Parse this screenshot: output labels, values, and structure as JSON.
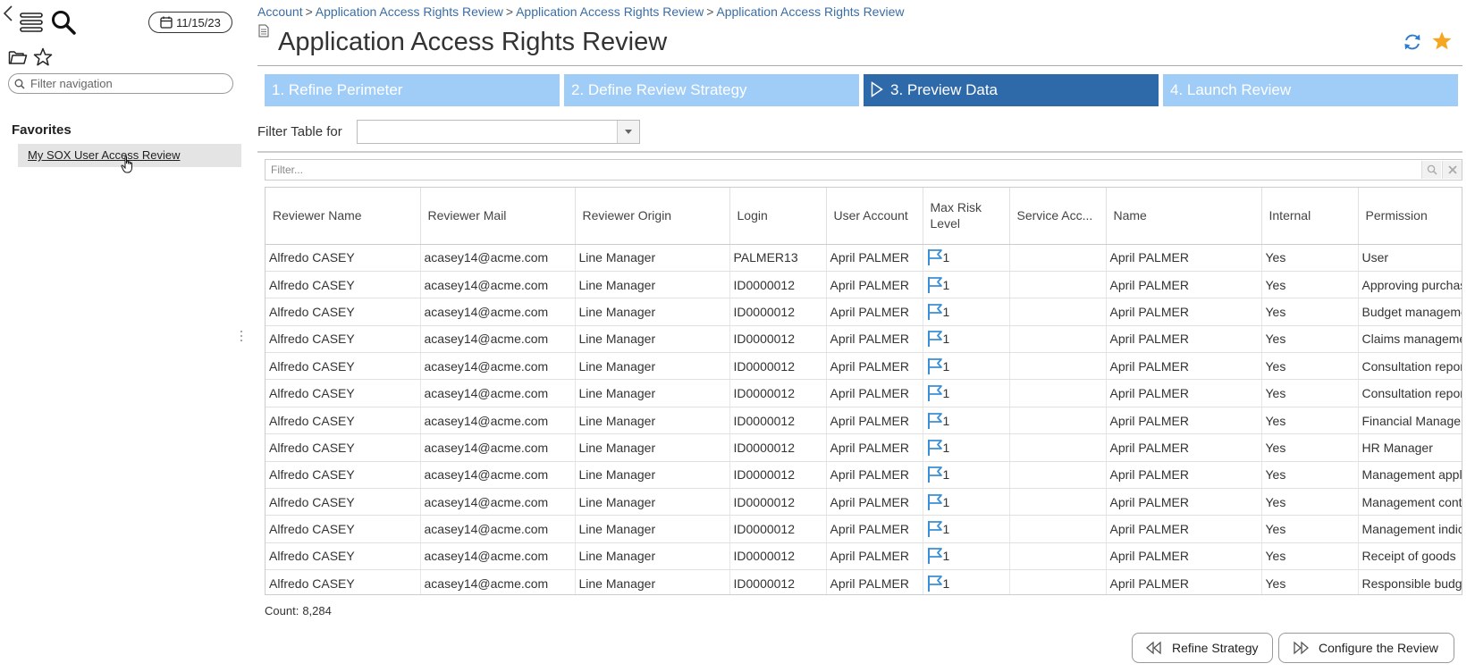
{
  "sidebar": {
    "date": "11/15/23",
    "filter_placeholder": "Filter navigation",
    "favorites_title": "Favorites",
    "favorites": [
      "My SOX User Access Review"
    ],
    "icons": [
      "back-icon",
      "menu-icon",
      "search-icon",
      "calendar-icon",
      "folder-icon",
      "star-icon",
      "hand-cursor-icon"
    ]
  },
  "breadcrumb": {
    "items": [
      "Account",
      "Application Access Rights Review",
      "Application Access Rights Review",
      "Application Access Rights Review"
    ],
    "separator": ">"
  },
  "page": {
    "title": "Application Access Rights Review"
  },
  "steps": [
    {
      "label": "1. Refine Perimeter",
      "active": false
    },
    {
      "label": "2. Define Review Strategy",
      "active": false
    },
    {
      "label": "3. Preview Data",
      "active": true
    },
    {
      "label": "4. Launch Review",
      "active": false
    }
  ],
  "filter_table": {
    "label": "Filter Table for",
    "value": ""
  },
  "grid": {
    "filter_placeholder": "Filter...",
    "columns": [
      "Reviewer Name",
      "Reviewer Mail",
      "Reviewer Origin",
      "Login",
      "User Account",
      "Max Risk Level",
      "Service Acc...",
      "Name",
      "Internal",
      "Permission"
    ],
    "rows": [
      [
        "Alfredo CASEY",
        "acasey14@acme.com",
        "Line Manager",
        "PALMER13",
        "April PALMER",
        "1",
        "",
        "April PALMER",
        "Yes",
        "User"
      ],
      [
        "Alfredo CASEY",
        "acasey14@acme.com",
        "Line Manager",
        "ID0000012",
        "April PALMER",
        "1",
        "",
        "April PALMER",
        "Yes",
        "Approving purchases"
      ],
      [
        "Alfredo CASEY",
        "acasey14@acme.com",
        "Line Manager",
        "ID0000012",
        "April PALMER",
        "1",
        "",
        "April PALMER",
        "Yes",
        "Budget management"
      ],
      [
        "Alfredo CASEY",
        "acasey14@acme.com",
        "Line Manager",
        "ID0000012",
        "April PALMER",
        "1",
        "",
        "April PALMER",
        "Yes",
        "Claims management"
      ],
      [
        "Alfredo CASEY",
        "acasey14@acme.com",
        "Line Manager",
        "ID0000012",
        "April PALMER",
        "1",
        "",
        "April PALMER",
        "Yes",
        "Consultation reports"
      ],
      [
        "Alfredo CASEY",
        "acasey14@acme.com",
        "Line Manager",
        "ID0000012",
        "April PALMER",
        "1",
        "",
        "April PALMER",
        "Yes",
        "Consultation reports"
      ],
      [
        "Alfredo CASEY",
        "acasey14@acme.com",
        "Line Manager",
        "ID0000012",
        "April PALMER",
        "1",
        "",
        "April PALMER",
        "Yes",
        "Financial Manager"
      ],
      [
        "Alfredo CASEY",
        "acasey14@acme.com",
        "Line Manager",
        "ID0000012",
        "April PALMER",
        "1",
        "",
        "April PALMER",
        "Yes",
        "HR Manager"
      ],
      [
        "Alfredo CASEY",
        "acasey14@acme.com",
        "Line Manager",
        "ID0000012",
        "April PALMER",
        "1",
        "",
        "April PALMER",
        "Yes",
        "Management application"
      ],
      [
        "Alfredo CASEY",
        "acasey14@acme.com",
        "Line Manager",
        "ID0000012",
        "April PALMER",
        "1",
        "",
        "April PALMER",
        "Yes",
        "Management control"
      ],
      [
        "Alfredo CASEY",
        "acasey14@acme.com",
        "Line Manager",
        "ID0000012",
        "April PALMER",
        "1",
        "",
        "April PALMER",
        "Yes",
        "Management indicators"
      ],
      [
        "Alfredo CASEY",
        "acasey14@acme.com",
        "Line Manager",
        "ID0000012",
        "April PALMER",
        "1",
        "",
        "April PALMER",
        "Yes",
        "Receipt of goods"
      ],
      [
        "Alfredo CASEY",
        "acasey14@acme.com",
        "Line Manager",
        "ID0000012",
        "April PALMER",
        "1",
        "",
        "April PALMER",
        "Yes",
        "Responsible budget"
      ]
    ]
  },
  "footer": {
    "count_label": "Count:",
    "count_value": "8,284",
    "refine_button": "Refine Strategy",
    "configure_button": "Configure the Review"
  },
  "colors": {
    "step_inactive": "#9fcdf7",
    "step_active": "#2e6aaa",
    "link": "#3a6da5",
    "risk_flag": "#3a8fd8",
    "favorite_star": "#f5a623"
  }
}
